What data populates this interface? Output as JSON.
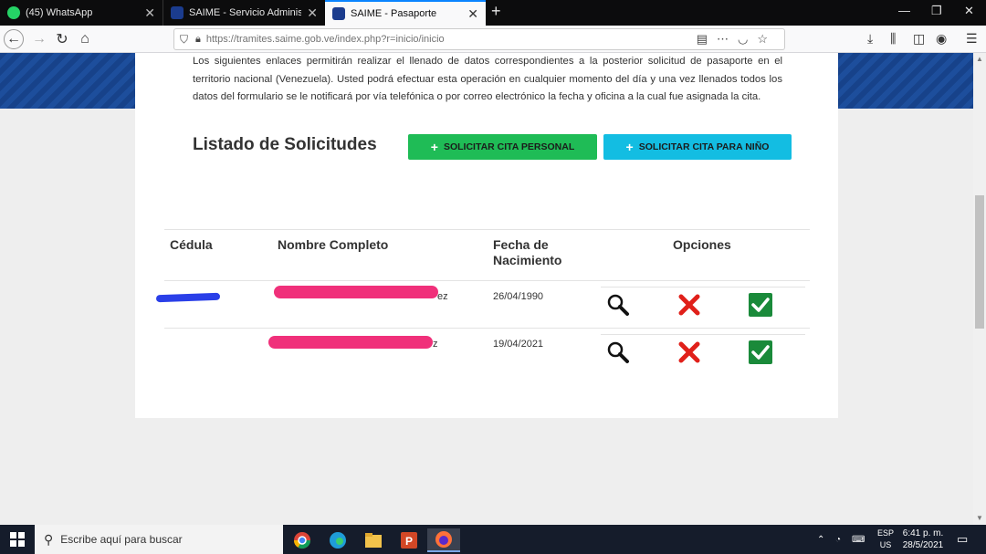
{
  "browser": {
    "tabs": [
      {
        "label": "(45) WhatsApp"
      },
      {
        "label": "SAIME - Servicio Administrativo"
      },
      {
        "label": "SAIME - Pasaporte"
      }
    ],
    "url": "https://tramites.saime.gob.ve/index.php?r=inicio/inicio"
  },
  "page": {
    "intro": "Los siguientes enlaces permitirán realizar el llenado de datos correspondientes a la posterior solicitud de pasaporte en el territorio nacional (Venezuela). Usted podrá efectuar esta operación en cualquier momento del día y una vez llenados todos los datos del formulario se le notificará por vía telefónica o por correo electrónico la fecha y oficina a la cual fue asignada la cita.",
    "list_title": "Listado de Solicitudes",
    "btn_personal": "SOLICITAR CITA PERSONAL",
    "btn_nino": "SOLICITAR CITA PARA NIÑO",
    "table": {
      "headers": [
        "Cédula",
        "Nombre Completo",
        "Fecha de Nacimiento",
        "Opciones"
      ],
      "rows": [
        {
          "nombre_suffix": "ez",
          "fecha": "26/04/1990"
        },
        {
          "nombre_suffix": "z",
          "fecha": "19/04/2021"
        }
      ]
    }
  },
  "taskbar": {
    "search_placeholder": "Escribe aquí para buscar",
    "lang_line1": "ESP",
    "lang_line2": "US",
    "time": "6:41 p. m.",
    "date": "28/5/2021"
  },
  "colors": {
    "btn_personal": "#1fbc56",
    "btn_nino": "#13bde2",
    "banner": "#17428a"
  }
}
